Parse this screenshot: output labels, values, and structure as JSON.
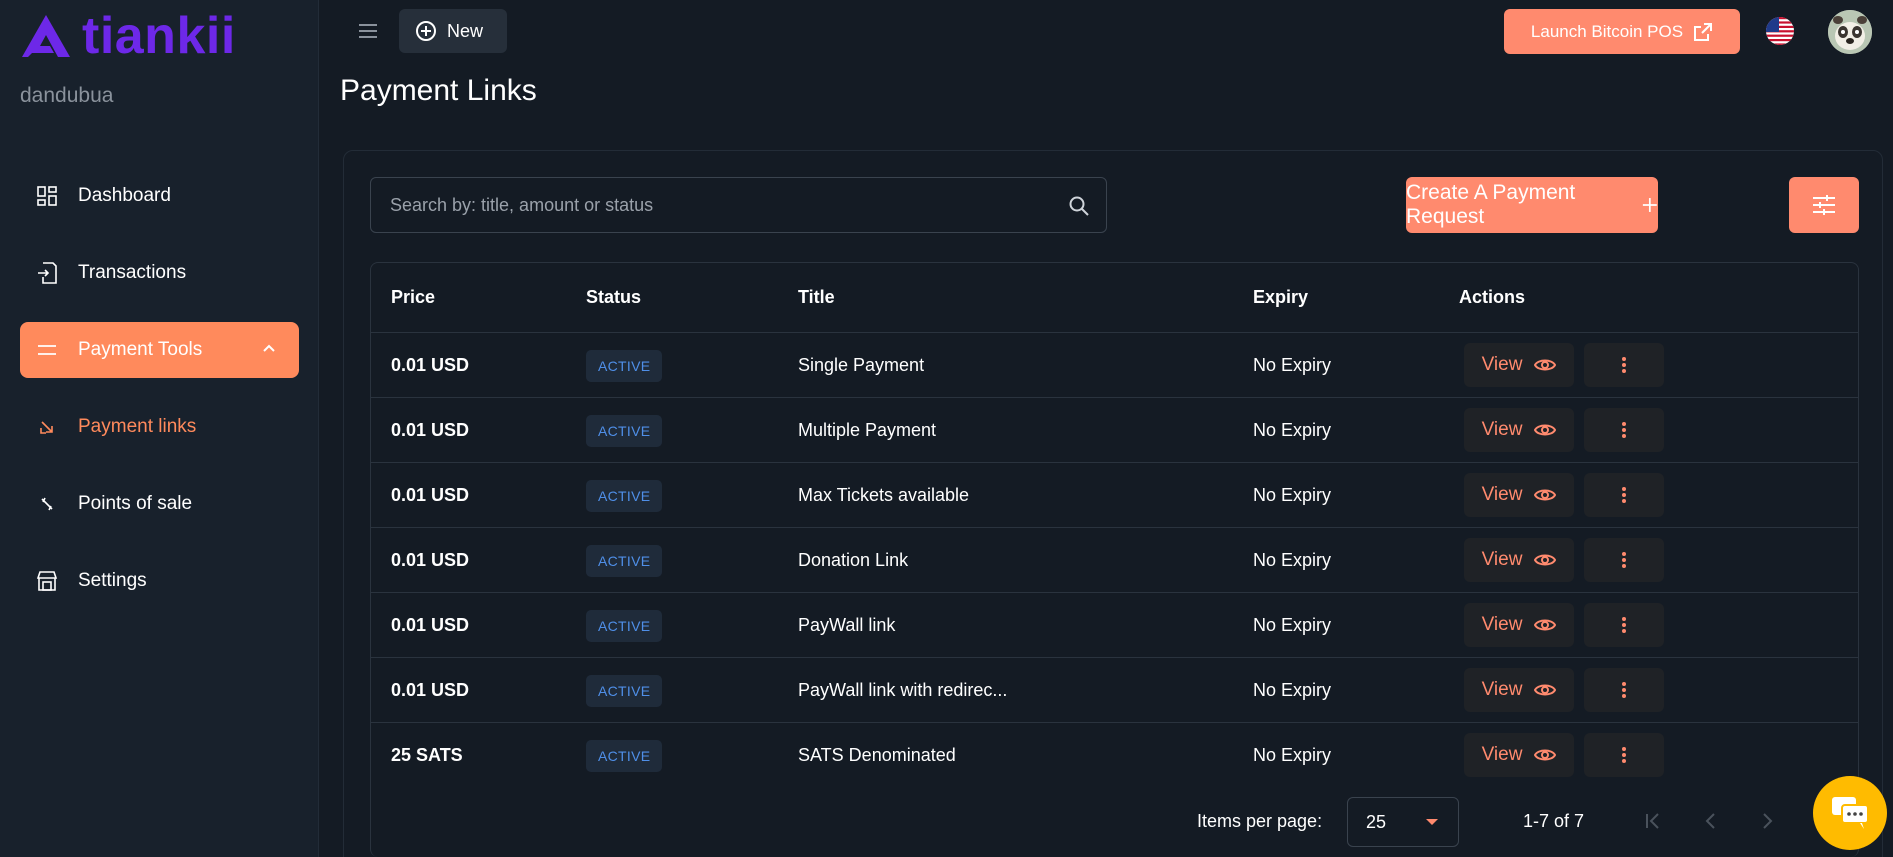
{
  "brand": {
    "name": "tiankii",
    "username": "dandubua"
  },
  "sidebar": {
    "items": [
      {
        "label": "Dashboard",
        "icon": "dashboard-icon"
      },
      {
        "label": "Transactions",
        "icon": "transactions-icon"
      },
      {
        "label": "Payment Tools",
        "icon": "menu-lines-icon",
        "expanded": true
      },
      {
        "label": "Payment links",
        "icon": "link-arrow-icon",
        "current": true
      },
      {
        "label": "Points of sale",
        "icon": "pos-icon"
      },
      {
        "label": "Settings",
        "icon": "store-icon"
      }
    ]
  },
  "topbar": {
    "new_label": "New",
    "launch_label": "Launch Bitcoin POS"
  },
  "page": {
    "title": "Payment Links"
  },
  "search": {
    "placeholder": "Search by: title, amount or status"
  },
  "actions": {
    "create_label": "Create A Payment Request"
  },
  "table": {
    "headers": [
      "Price",
      "Status",
      "Title",
      "Expiry",
      "Actions"
    ],
    "view_label": "View",
    "rows": [
      {
        "price": "0.01 USD",
        "status": "ACTIVE",
        "title": "Single Payment",
        "expiry": "No Expiry"
      },
      {
        "price": "0.01 USD",
        "status": "ACTIVE",
        "title": "Multiple Payment",
        "expiry": "No Expiry"
      },
      {
        "price": "0.01 USD",
        "status": "ACTIVE",
        "title": "Max Tickets available",
        "expiry": "No Expiry"
      },
      {
        "price": "0.01 USD",
        "status": "ACTIVE",
        "title": "Donation Link",
        "expiry": "No Expiry"
      },
      {
        "price": "0.01 USD",
        "status": "ACTIVE",
        "title": "PayWall link",
        "expiry": "No Expiry"
      },
      {
        "price": "0.01 USD",
        "status": "ACTIVE",
        "title": "PayWall link with redirec...",
        "expiry": "No Expiry"
      },
      {
        "price": "25 SATS",
        "status": "ACTIVE",
        "title": "SATS Denominated",
        "expiry": "No Expiry"
      }
    ]
  },
  "pagination": {
    "items_per_page_label": "Items per page:",
    "items_per_page": "25",
    "range": "1-7 of 7"
  },
  "colors": {
    "accent": "#ff8a6e",
    "brand": "#6d28e8",
    "badge_text": "#4f8fe8",
    "bg": "#141b24"
  }
}
